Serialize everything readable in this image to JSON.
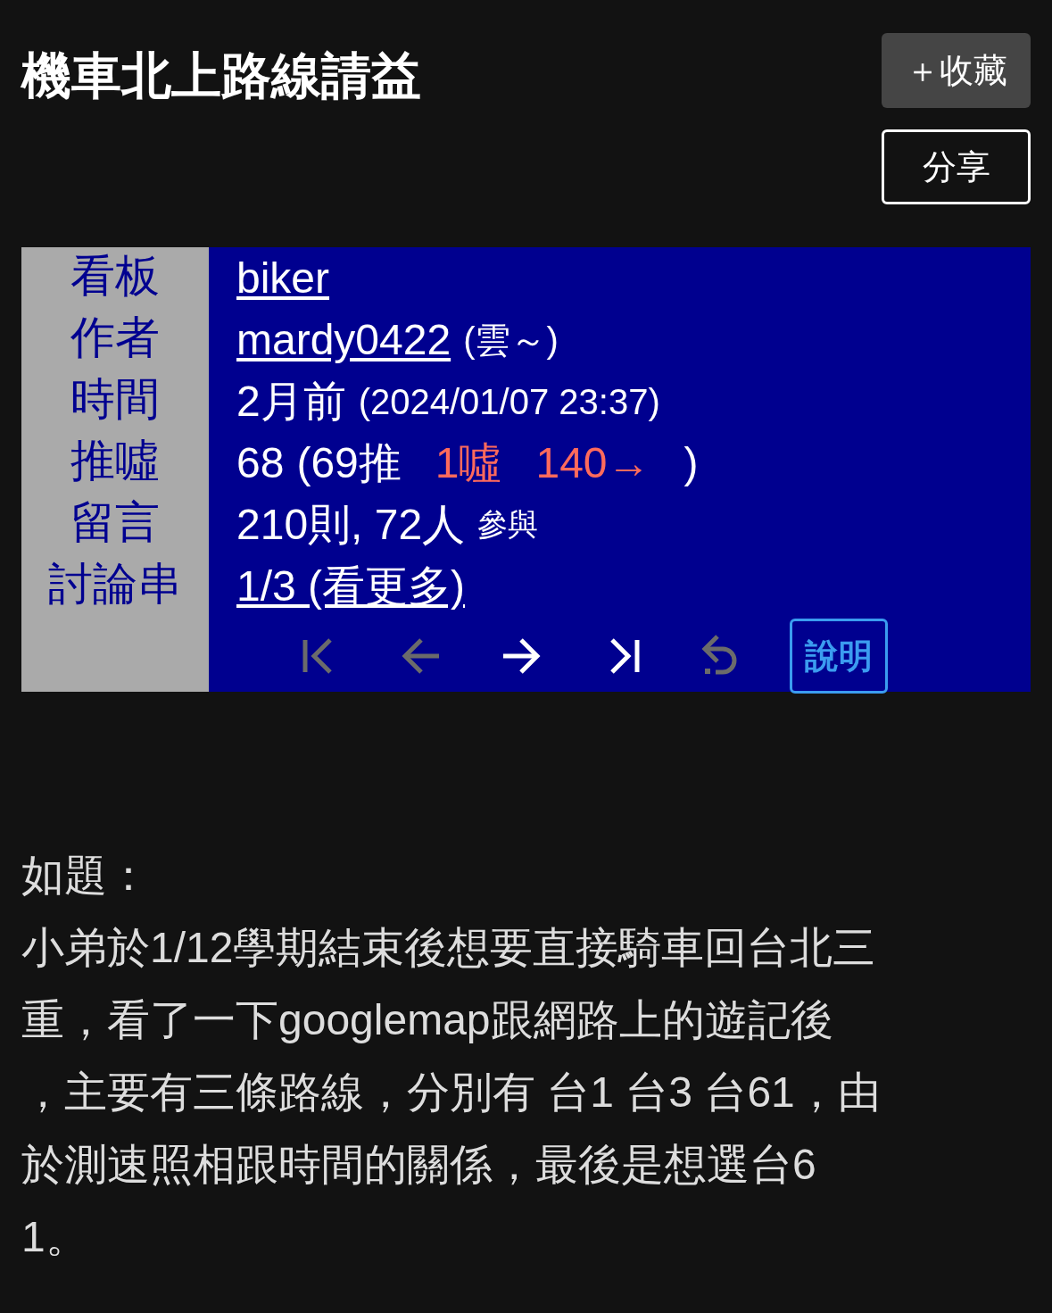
{
  "title": "機車北上路線請益",
  "buttons": {
    "favorite": "＋收藏",
    "share": "分享"
  },
  "info": [
    {
      "label": "看板",
      "parts": [
        {
          "text": "biker",
          "kind": "link",
          "color": "#ffffff"
        }
      ]
    },
    {
      "label": "作者",
      "parts": [
        {
          "text": "mardy0422",
          "kind": "link",
          "color": "#ffffff"
        },
        {
          "text": "(雲～)",
          "kind": "small",
          "color": "#ffffff"
        }
      ]
    },
    {
      "label": "時間",
      "parts": [
        {
          "text": "2月前",
          "kind": "plain",
          "color": "#ffffff"
        },
        {
          "text": "(2024/01/07 23:37)",
          "kind": "small",
          "color": "#ffffff"
        }
      ]
    },
    {
      "label": "推噓",
      "parts": [
        {
          "text": "68",
          "kind": "plain",
          "color": "#ffffff"
        },
        {
          "text": "(69推",
          "kind": "plain",
          "color": "#ffffff"
        },
        {
          "text": "1噓",
          "kind": "plain",
          "color": "#ff6a5c"
        },
        {
          "text": "140→",
          "kind": "plain",
          "color": "#ff6a5c"
        },
        {
          "text": ")",
          "kind": "plain",
          "color": "#ffffff"
        }
      ]
    },
    {
      "label": "留言",
      "parts": [
        {
          "text": "210則, 72人",
          "kind": "plain",
          "color": "#ffffff"
        },
        {
          "text": "參與",
          "kind": "tiny",
          "color": "#ffffff"
        }
      ]
    },
    {
      "label": "討論串",
      "parts": [
        {
          "text": "1/3 (看更多)",
          "kind": "link",
          "color": "#ffffff"
        }
      ]
    }
  ],
  "nav": [
    {
      "kind": "first",
      "disabled": true
    },
    {
      "kind": "prev",
      "disabled": true
    },
    {
      "kind": "next",
      "disabled": false
    },
    {
      "kind": "last",
      "disabled": false
    },
    {
      "kind": "back",
      "disabled": true
    }
  ],
  "help": "說明",
  "body": [
    "如題：",
    "小弟於1/12學期結束後想要直接騎車回台北三",
    "重，看了一下googlemap跟網路上的遊記後",
    "，主要有三條路線，分別有 台1 台3 台61，由",
    "於測速照相跟時間的關係，最後是想選台6",
    "1。"
  ]
}
